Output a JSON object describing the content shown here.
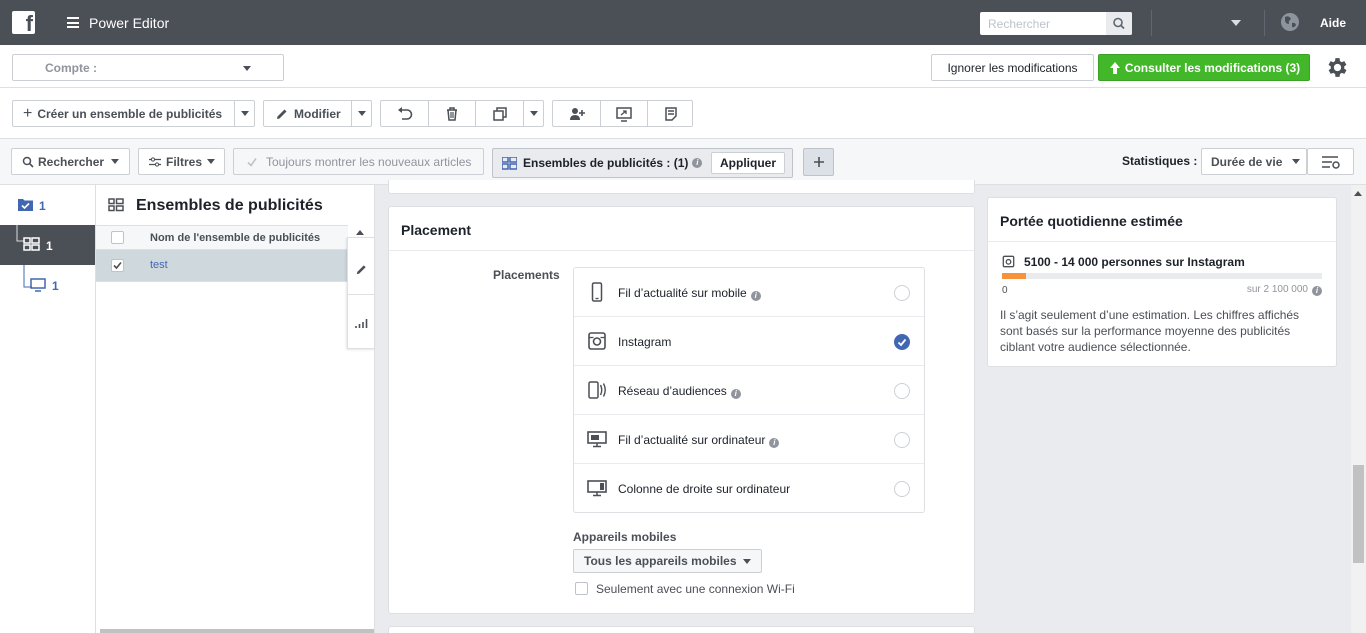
{
  "topbar": {
    "app_title": "Power Editor",
    "search_placeholder": "Rechercher",
    "help_label": "Aide",
    "logo_letter": "f"
  },
  "account": {
    "label": "Compte :"
  },
  "actions": {
    "discard_label": "Ignorer les modifications",
    "review_label": "Consulter les modifications (3)"
  },
  "toolbar": {
    "create_label": "Créer un ensemble de publicités",
    "edit_label": "Modifier"
  },
  "filterbar": {
    "search_label": "Rechercher",
    "filters_label": "Filtres",
    "always_show_label": "Toujours montrer les nouveaux articles",
    "selection_label": "Ensembles de publicités : (1)",
    "apply_label": "Appliquer",
    "stats_label": "Statistiques :",
    "stats_value": "Durée de vie"
  },
  "leftnav": {
    "items": [
      {
        "count": "1",
        "icon": "campaign-folder-icon"
      },
      {
        "count": "1",
        "icon": "adset-grid-icon"
      },
      {
        "count": "1",
        "icon": "ad-monitor-icon"
      }
    ]
  },
  "list": {
    "title": "Ensembles de publicités",
    "column": "Nom de l'ensemble de publicités",
    "rows": [
      {
        "name": "test",
        "checked": true
      }
    ]
  },
  "placement": {
    "title": "Placement",
    "label": "Placements",
    "items": [
      {
        "name": "Fil d’actualité sur mobile",
        "info": true,
        "selected": false
      },
      {
        "name": "Instagram",
        "info": false,
        "selected": true
      },
      {
        "name": "Réseau d’audiences",
        "info": true,
        "selected": false
      },
      {
        "name": "Fil d’actualité sur ordinateur",
        "info": true,
        "selected": false
      },
      {
        "name": "Colonne de droite sur ordinateur",
        "info": false,
        "selected": false
      }
    ],
    "mobile_label": "Appareils mobiles",
    "mobile_value": "Tous les appareils mobiles",
    "wifi_label": "Seulement avec une connexion Wi-Fi"
  },
  "reach": {
    "title": "Portée quotidienne estimée",
    "range": "5100 - 14 000 personnes sur Instagram",
    "min": "0",
    "max": "sur 2 100 000",
    "fill_fraction": 0.075,
    "note": "Il s’agit seulement d’une estimation. Les chiffres affichés sont basés sur la performance moyenne des publicités ciblant votre audience sélectionnée."
  },
  "colors": {
    "topbar": "#4b4f56",
    "primary": "#42b72a",
    "link": "#4267b2",
    "reach_fill": "#f7923b"
  }
}
